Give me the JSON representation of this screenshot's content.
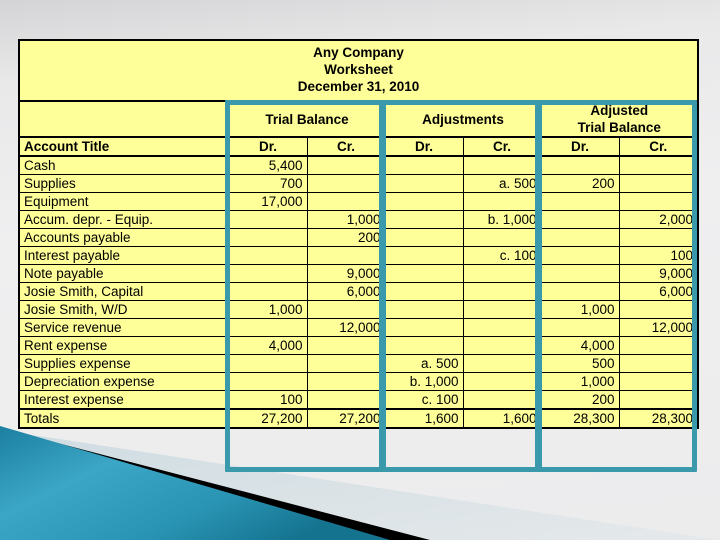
{
  "slide": {
    "background_color": "#ececed",
    "accent_color": "#3a9aac",
    "sheet_color": "#ffff99"
  },
  "worksheet": {
    "title_lines": [
      "Any Company",
      "Worksheet",
      "December 31, 2010"
    ],
    "company": "Any Company",
    "statement": "Worksheet",
    "date": "December 31, 2010",
    "group_headers": [
      {
        "label": "",
        "sub": ""
      },
      {
        "label": "Trial Balance",
        "sub": ""
      },
      {
        "label": "Adjustments",
        "sub": ""
      },
      {
        "label": "Adjusted",
        "sub": "Trial Balance"
      }
    ],
    "column_headers": [
      "Account Title",
      "Dr.",
      "Cr.",
      "Dr.",
      "Cr.",
      "Dr.",
      "Cr."
    ],
    "rows": [
      {
        "account": "Cash",
        "tb_dr": "5,400",
        "tb_cr": "",
        "adj_dr": "",
        "adj_cr": "",
        "atb_dr": "",
        "atb_cr": ""
      },
      {
        "account": "Supplies",
        "tb_dr": "700",
        "tb_cr": "",
        "adj_dr": "",
        "adj_cr": "a. 500",
        "atb_dr": "200",
        "atb_cr": ""
      },
      {
        "account": "Equipment",
        "tb_dr": "17,000",
        "tb_cr": "",
        "adj_dr": "",
        "adj_cr": "",
        "atb_dr": "",
        "atb_cr": ""
      },
      {
        "account": "Accum. depr. - Equip.",
        "tb_dr": "",
        "tb_cr": "1,000",
        "adj_dr": "",
        "adj_cr": "b. 1,000",
        "atb_dr": "",
        "atb_cr": "2,000"
      },
      {
        "account": "Accounts payable",
        "tb_dr": "",
        "tb_cr": "200",
        "adj_dr": "",
        "adj_cr": "",
        "atb_dr": "",
        "atb_cr": ""
      },
      {
        "account": "Interest payable",
        "tb_dr": "",
        "tb_cr": "",
        "adj_dr": "",
        "adj_cr": "c. 100",
        "atb_dr": "",
        "atb_cr": "100"
      },
      {
        "account": "Note payable",
        "tb_dr": "",
        "tb_cr": "9,000",
        "adj_dr": "",
        "adj_cr": "",
        "atb_dr": "",
        "atb_cr": "9,000"
      },
      {
        "account": "Josie Smith, Capital",
        "tb_dr": "",
        "tb_cr": "6,000",
        "adj_dr": "",
        "adj_cr": "",
        "atb_dr": "",
        "atb_cr": "6,000"
      },
      {
        "account": "Josie Smith, W/D",
        "tb_dr": "1,000",
        "tb_cr": "",
        "adj_dr": "",
        "adj_cr": "",
        "atb_dr": "1,000",
        "atb_cr": ""
      },
      {
        "account": "Service revenue",
        "tb_dr": "",
        "tb_cr": "12,000",
        "adj_dr": "",
        "adj_cr": "",
        "atb_dr": "",
        "atb_cr": "12,000"
      },
      {
        "account": "Rent expense",
        "tb_dr": "4,000",
        "tb_cr": "",
        "adj_dr": "",
        "adj_cr": "",
        "atb_dr": "4,000",
        "atb_cr": ""
      },
      {
        "account": "Supplies expense",
        "tb_dr": "",
        "tb_cr": "",
        "adj_dr": "a. 500",
        "adj_cr": "",
        "atb_dr": "500",
        "atb_cr": ""
      },
      {
        "account": "Depreciation expense",
        "tb_dr": "",
        "tb_cr": "",
        "adj_dr": "b. 1,000",
        "adj_cr": "",
        "atb_dr": "1,000",
        "atb_cr": ""
      },
      {
        "account": "Interest expense",
        "tb_dr": "100",
        "tb_cr": "",
        "adj_dr": "c. 100",
        "adj_cr": "",
        "atb_dr": "200",
        "atb_cr": ""
      }
    ],
    "totals": {
      "account": "Totals",
      "tb_dr": "27,200",
      "tb_cr": "27,200",
      "adj_dr": "1,600",
      "adj_cr": "1,600",
      "atb_dr": "28,300",
      "atb_cr": "28,300"
    }
  }
}
